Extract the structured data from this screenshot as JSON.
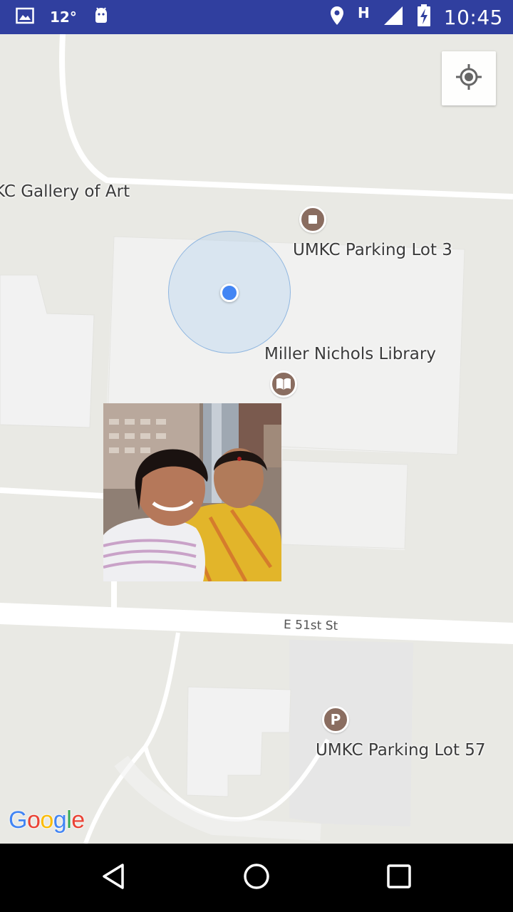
{
  "status_bar": {
    "temperature": "12°",
    "network": "H",
    "time": "10:45",
    "icons": [
      "image-notification-icon",
      "android-icon",
      "location-icon",
      "signal-icon",
      "battery-charging-icon"
    ]
  },
  "map": {
    "labels": {
      "gallery": "KC Gallery of Art",
      "parking_lot_3": "UMKC Parking Lot 3",
      "library": "Miller Nichols Library",
      "street": "E 51st St",
      "parking_lot_57": "UMKC Parking Lot 57"
    },
    "poi_icons": {
      "parking_lot_3": "square-poi-icon",
      "library": "book-icon",
      "parking_lot_57": "P"
    },
    "my_location_icon": "my-location-icon",
    "photo_marker": "selfie photo of two people",
    "attribution": {
      "letters": [
        "G",
        "o",
        "o",
        "g",
        "l",
        "e"
      ],
      "colors": [
        "#4285f4",
        "#ea4335",
        "#fbbc05",
        "#4285f4",
        "#34a853",
        "#ea4335"
      ]
    },
    "colors": {
      "background": "#e9e9e4",
      "building": "#f2f2f2",
      "road": "#ffffff",
      "poi": "#8a6d60",
      "location": "#4285f4"
    }
  },
  "nav_bar": {
    "icons": [
      "back-icon",
      "home-icon",
      "recents-icon"
    ]
  }
}
